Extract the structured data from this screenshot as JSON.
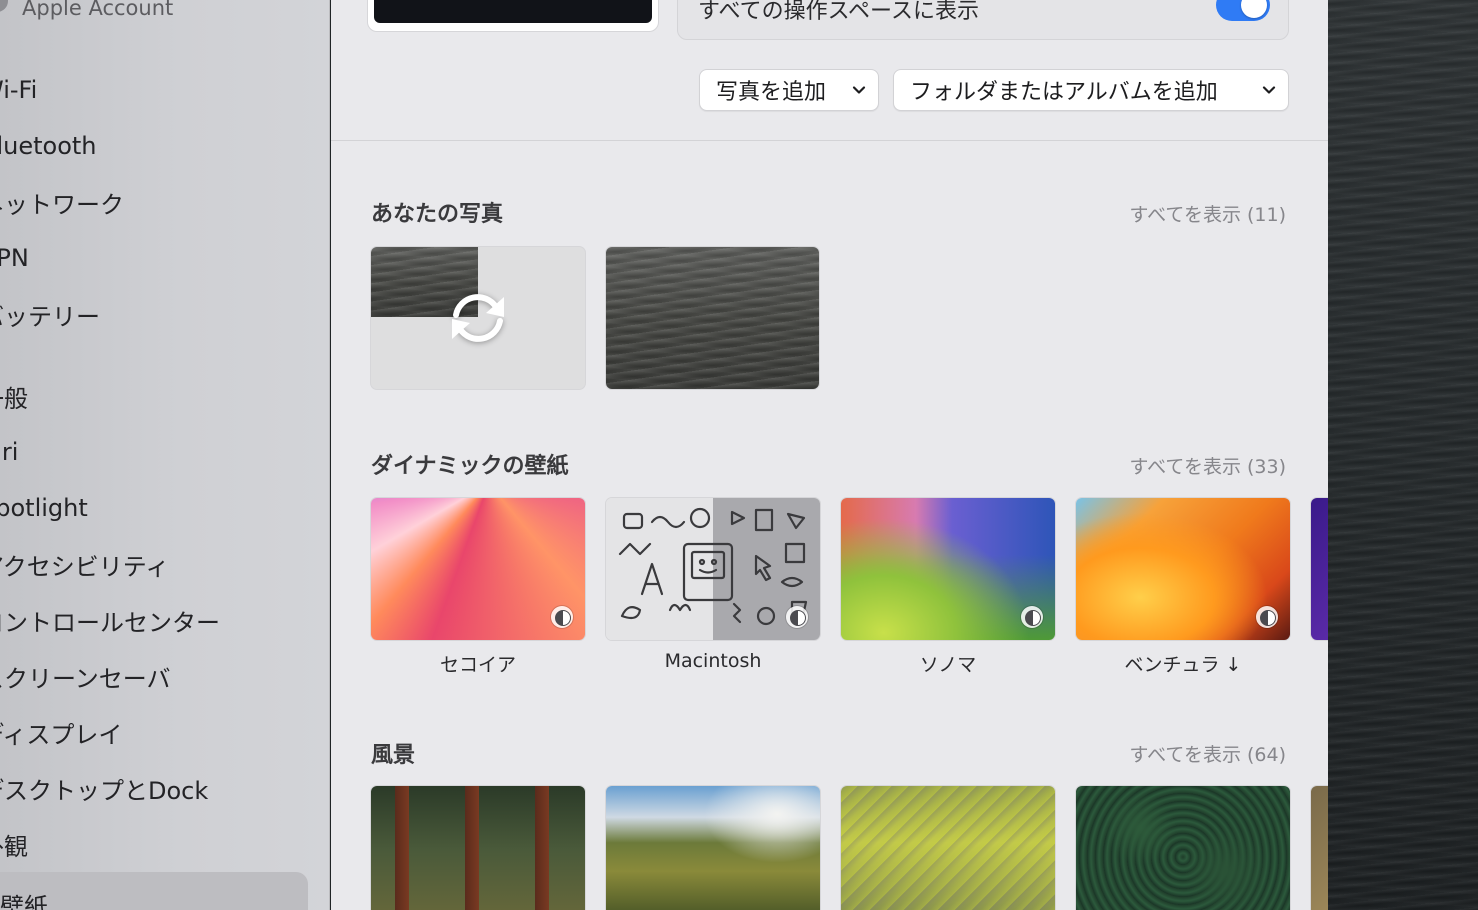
{
  "sidebar": {
    "account_label": "Apple Account",
    "items": [
      {
        "label": "Wi-Fi"
      },
      {
        "label": "Bluetooth"
      },
      {
        "label": "ネットワーク"
      },
      {
        "label": "VPN"
      },
      {
        "label": "バッテリー"
      },
      {
        "label": "一般"
      },
      {
        "label": "Siri"
      },
      {
        "label": "Spotlight"
      },
      {
        "label": "アクセシビリティ"
      },
      {
        "label": "コントロールセンター"
      },
      {
        "label": "スクリーンセーバ"
      },
      {
        "label": "ディスプレイ"
      },
      {
        "label": "デスクトップとDock"
      },
      {
        "label": "外観"
      },
      {
        "label": "壁紙",
        "selected": true
      }
    ]
  },
  "header": {
    "show_all_spaces_label": "すべての操作スペースに表示",
    "show_all_spaces_enabled": true,
    "add_photo_label": "写真を追加",
    "add_folder_label": "フォルダまたはアルバムを追加"
  },
  "sections": {
    "your_photos": {
      "title": "あなたの写真",
      "show_all": "すべてを表示 (11)"
    },
    "dynamic": {
      "title": "ダイナミックの壁紙",
      "show_all": "すべてを表示 (33)",
      "items": [
        {
          "caption": "セコイア"
        },
        {
          "caption": "Macintosh"
        },
        {
          "caption": "ソノマ"
        },
        {
          "caption": "ベンチュラ ↓"
        }
      ]
    },
    "landscape": {
      "title": "風景",
      "show_all": "すべてを表示 (64)"
    }
  },
  "colors": {
    "accent": "#2f7bf5",
    "panel_background": "#e9e9ec",
    "sidebar_background": "#cfd0d4"
  }
}
